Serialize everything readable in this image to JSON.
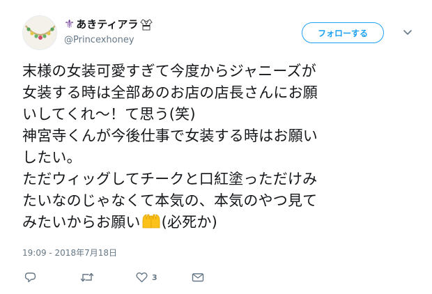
{
  "user": {
    "name": "あきティアラ",
    "handle": "@Princexhoney"
  },
  "follow_label": "フォローする",
  "tweet_lines": [
    "末様の女装可愛すぎて今度からジャニーズが",
    "女装する時は全部あのお店の店長さんにお願",
    "いしてくれ〜！て思う(笑)",
    "神宮寺くんが今後仕事で女装する時はお願い",
    "したい。",
    "ただウィッグしてチークと口紅塗っただけみ",
    "たいなのじゃなくて本気の、本気のやつ見て",
    "みたいからお願い",
    "(必死か)"
  ],
  "timestamp": "19:09 - 2018年7月18日",
  "actions": {
    "reply_count": "",
    "retweet_count": "",
    "like_count": "3"
  },
  "icons": [
    "fleur-de-lis-icon",
    "gi-uniform-icon",
    "chevron-down-icon",
    "praising-hands-emoji",
    "reply-icon",
    "retweet-icon",
    "heart-icon",
    "envelope-icon"
  ],
  "colors": {
    "accent": "#1da1f2",
    "text": "#14171a",
    "secondary": "#657786"
  }
}
